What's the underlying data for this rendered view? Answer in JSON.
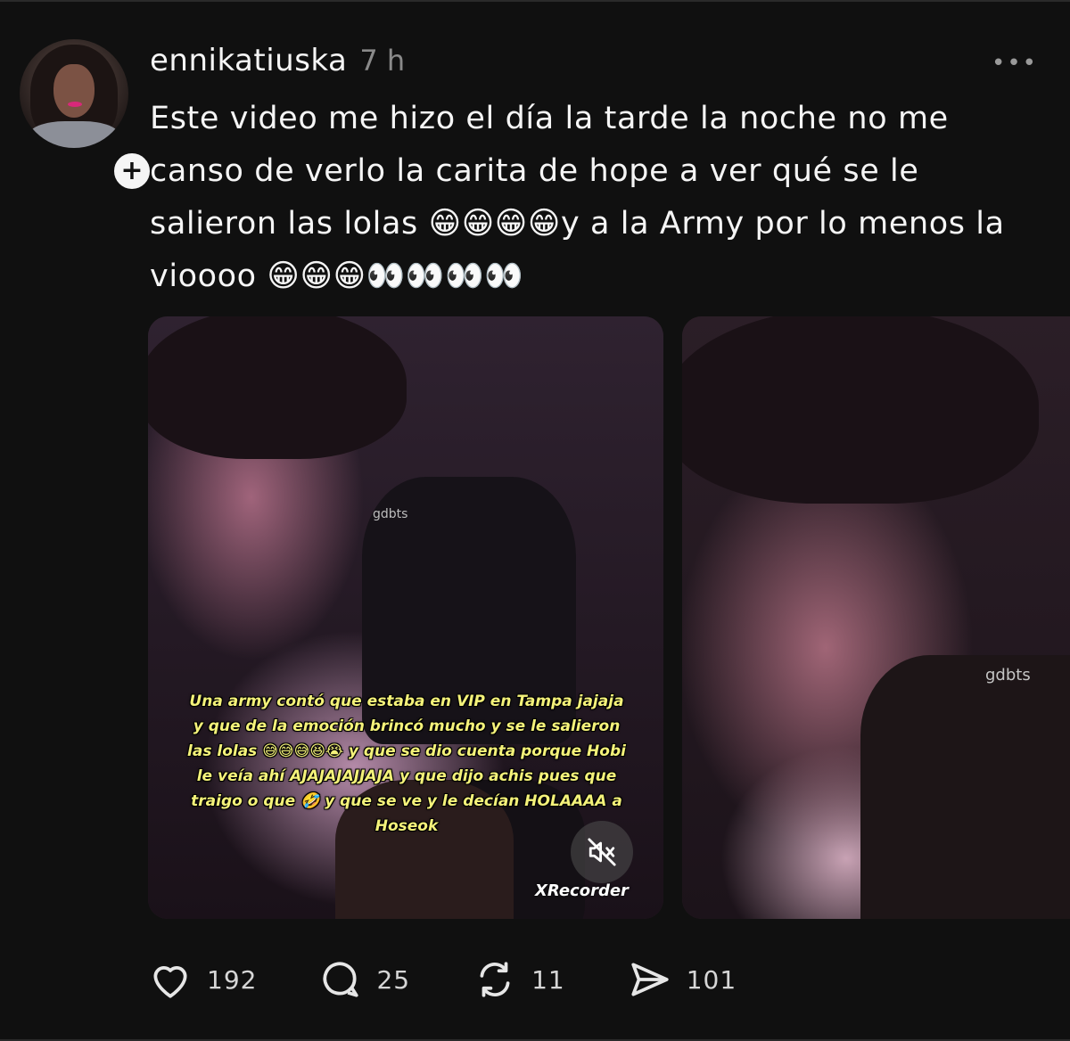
{
  "post": {
    "username": "ennikatiuska",
    "timestamp": "7 h",
    "more_label": "•••",
    "follow_label": "+",
    "text": "Este video me hizo el día la tarde la noche no me canso de verlo la carita de hope a ver qué se le salieron las lolas 😁😁😁😁y a la Army por lo menos la vioooo 😁😁😁👀👀👀👀"
  },
  "media": [
    {
      "caption": "Una army contó que estaba en VIP en Tampa jajaja y que de la emoción brincó mucho y se le salieron las lolas 😅😅😅😆😭 y que se dio cuenta porque Hobi le veía ahí AJAJAJAJJAJA y que dijo achis pues que traigo o que 🤣 y que se ve y le decían HOLAAAA a Hoseok",
      "watermark": "XRecorder",
      "tag": "gdbts"
    },
    {
      "tag": "gdbts"
    }
  ],
  "actions": {
    "likes": "192",
    "replies": "25",
    "reposts": "11",
    "shares": "101"
  },
  "colors": {
    "background": "#101010",
    "text": "#f5f5f5",
    "muted": "#8a8a8a",
    "caption_yellow": "#f4f27a"
  }
}
